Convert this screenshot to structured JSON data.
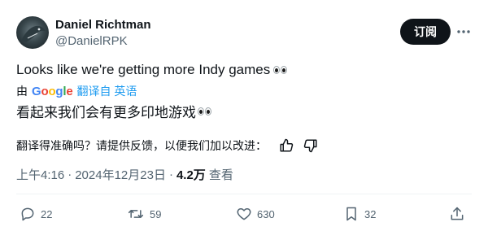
{
  "author": {
    "display_name": "Daniel Richtman",
    "handle": "@DanielRPK",
    "avatar_icon": "shark-avatar-icon"
  },
  "header": {
    "subscribe_label": "订阅",
    "more_icon": "more-icon"
  },
  "tweet": {
    "text": "Looks like we're getting more Indy games",
    "emoji": "eyes-emoji"
  },
  "translation": {
    "by_label": "由",
    "provider": "Google",
    "provider_letters": [
      "G",
      "o",
      "o",
      "g",
      "l",
      "e"
    ],
    "link_label": "翻译自 英语",
    "translated_text": "看起来我们会有更多印地游戏",
    "feedback_prompt": "翻译得准确吗？请提供反馈，以便我们加以改进：",
    "thumbs_up_icon": "thumbs-up-icon",
    "thumbs_down_icon": "thumbs-down-icon"
  },
  "meta": {
    "time": "上午4:16",
    "separator": "·",
    "date": "2024年12月23日",
    "views_count": "4.2万",
    "views_label": "查看"
  },
  "actions": {
    "reply_count": "22",
    "retweet_count": "59",
    "like_count": "630",
    "bookmark_count": "32"
  },
  "colors": {
    "text": "#0f1419",
    "secondary": "#536471",
    "link": "#1d9bf0",
    "button_bg": "#0f1419",
    "divider": "#eff3f4"
  }
}
